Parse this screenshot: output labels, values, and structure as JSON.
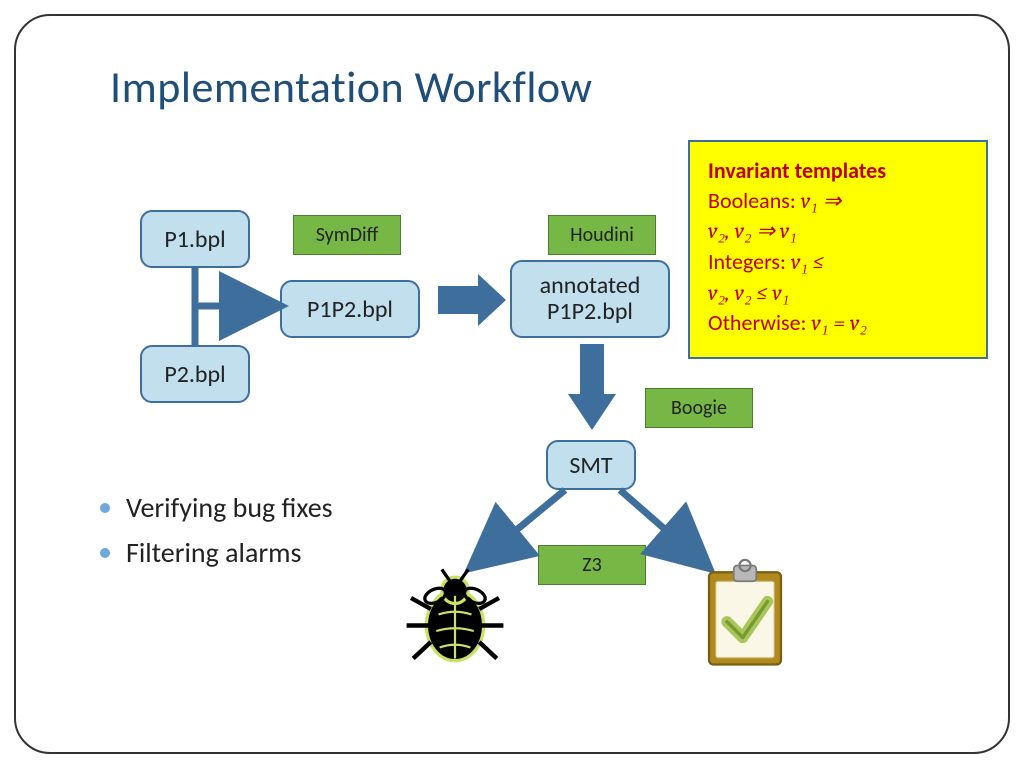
{
  "title": "Implementation Workflow",
  "nodes": {
    "p1": "P1.bpl",
    "p2": "P2.bpl",
    "p1p2": "P1P2.bpl",
    "annotated_line1": "annotated",
    "annotated_line2": "P1P2.bpl",
    "smt": "SMT"
  },
  "tags": {
    "symdiff": "SymDiff",
    "houdini": "Houdini",
    "boogie": "Boogie",
    "z3": "Z3"
  },
  "callout": {
    "heading": "Invariant templates",
    "boolean_prefix": "Booleans: ",
    "boolean_expr_a": "v₁ ⇒",
    "boolean_expr_b": "v₂, v₂ ⇒ v₁",
    "integer_prefix": "Integers: ",
    "integer_expr_a": "v₁ ≤",
    "integer_expr_b": "v₂, v₂ ≤ v₁",
    "otherwise_prefix": "Otherwise: ",
    "otherwise_expr": "v₁ = v₂"
  },
  "bullets": {
    "b1": "Verifying bug fixes",
    "b2": "Filtering alarms"
  }
}
